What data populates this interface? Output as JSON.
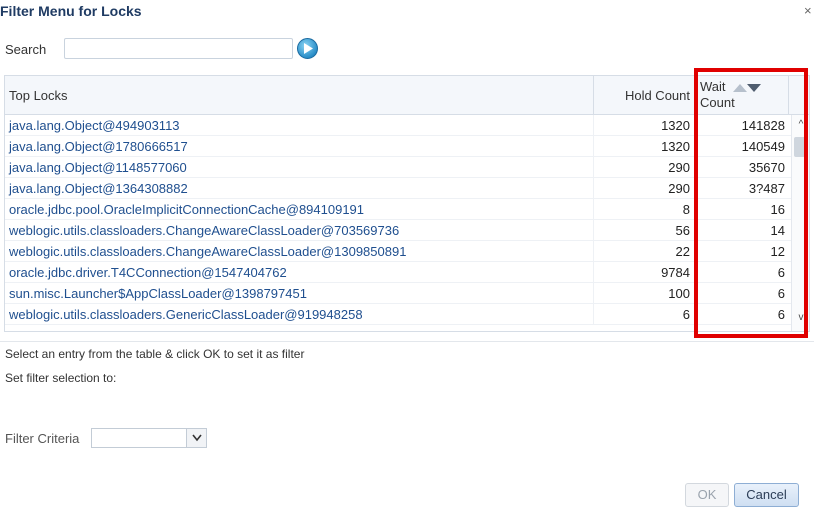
{
  "dialog": {
    "title": "Filter Menu for Locks",
    "close_glyph": "×"
  },
  "search": {
    "label": "Search",
    "value": "",
    "placeholder": ""
  },
  "table": {
    "columns": {
      "locks": "Top Locks",
      "hold": "Hold Count",
      "wait_line1": "Wait",
      "wait_line2": "Count"
    },
    "sort": {
      "column": "Wait Count",
      "direction": "descending"
    },
    "rows": [
      {
        "lock": "java.lang.Object@494903113",
        "hold": "1320",
        "wait": "141828"
      },
      {
        "lock": "java.lang.Object@1780666517",
        "hold": "1320",
        "wait": "140549"
      },
      {
        "lock": "java.lang.Object@1148577060",
        "hold": "290",
        "wait": "35670"
      },
      {
        "lock": "java.lang.Object@1364308882",
        "hold": "290",
        "wait": "3?487"
      },
      {
        "lock": "oracle.jdbc.pool.OracleImplicitConnectionCache@894109191",
        "hold": "8",
        "wait": "16"
      },
      {
        "lock": "weblogic.utils.classloaders.ChangeAwareClassLoader@703569736",
        "hold": "56",
        "wait": "14"
      },
      {
        "lock": "weblogic.utils.classloaders.ChangeAwareClassLoader@1309850891",
        "hold": "22",
        "wait": "12"
      },
      {
        "lock": "oracle.jdbc.driver.T4CConnection@1547404762",
        "hold": "9784",
        "wait": "6"
      },
      {
        "lock": "sun.misc.Launcher$AppClassLoader@1398797451",
        "hold": "100",
        "wait": "6"
      },
      {
        "lock": "weblogic.utils.classloaders.GenericClassLoader@919948258",
        "hold": "6",
        "wait": "6"
      }
    ],
    "scroll_up_glyph": "^",
    "scroll_down_glyph": "v"
  },
  "hint": "Select an entry from the table & click OK to set it as filter",
  "set_filter_label": "Set filter selection to:",
  "filter_criteria": {
    "label": "Filter Criteria",
    "value": ""
  },
  "buttons": {
    "ok": "OK",
    "cancel": "Cancel"
  },
  "colors": {
    "title": "#1f3b63",
    "link": "#1f4f8f",
    "highlight_box": "#e00000"
  },
  "icons": [
    "go-arrow-icon",
    "close-icon",
    "sort-ascending-icon",
    "sort-descending-icon",
    "dropdown-arrow-icon"
  ]
}
